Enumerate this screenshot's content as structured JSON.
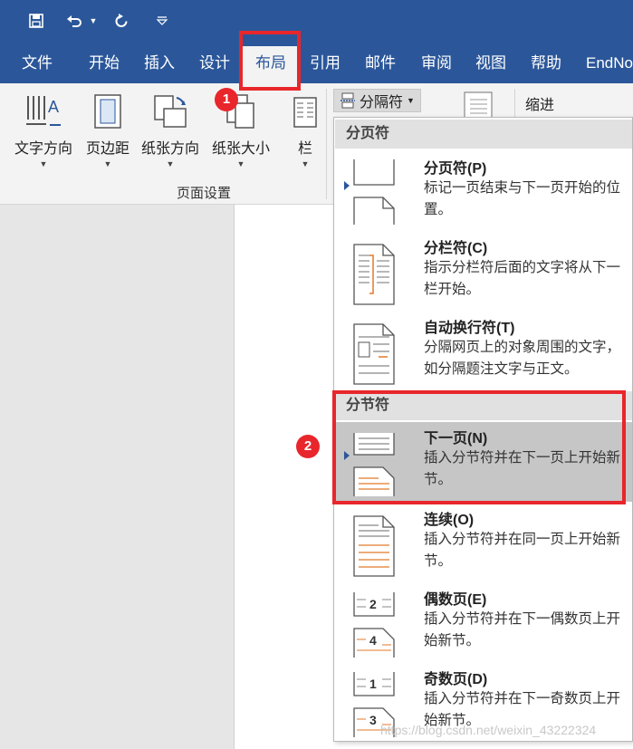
{
  "quick_access": {
    "save_icon": "save-icon",
    "undo_icon": "undo-icon",
    "redo_icon": "redo-icon",
    "customize_icon": "customize-caret-icon"
  },
  "tabs": [
    "文件",
    "开始",
    "插入",
    "设计",
    "布局",
    "引用",
    "邮件",
    "审阅",
    "视图",
    "帮助",
    "EndNo"
  ],
  "active_tab": "布局",
  "ribbon": {
    "buttons": [
      "文字方向",
      "页边距",
      "纸张方向",
      "纸张大小",
      "栏"
    ],
    "group_label": "页面设置",
    "breaks_label": "分隔符",
    "indent_label": "缩进"
  },
  "callouts": {
    "badge1": "1",
    "badge2": "2"
  },
  "colors": {
    "accent": "#2b579a",
    "highlight_red": "#e8262b",
    "menu_hover": "#c6c6c6"
  },
  "menu": {
    "page_breaks_header": "分页符",
    "section_breaks_header": "分节符",
    "items": [
      {
        "title": "分页符(P)",
        "desc": "标记一页结束与下一页开始的位置。"
      },
      {
        "title": "分栏符(C)",
        "desc": "指示分栏符后面的文字将从下一栏开始。"
      },
      {
        "title": "自动换行符(T)",
        "desc": "分隔网页上的对象周围的文字，如分隔题注文字与正文。"
      },
      {
        "title": "下一页(N)",
        "desc": "插入分节符并在下一页上开始新节。"
      },
      {
        "title": "连续(O)",
        "desc": "插入分节符并在同一页上开始新节。"
      },
      {
        "title": "偶数页(E)",
        "desc": "插入分节符并在下一偶数页上开始新节。"
      },
      {
        "title": "奇数页(D)",
        "desc": "插入分节符并在下一奇数页上开始新节。"
      }
    ],
    "even_page_digits": [
      "2",
      "4"
    ],
    "odd_page_digits": [
      "1",
      "3"
    ]
  },
  "watermark": "https://blog.csdn.net/weixin_43222324"
}
